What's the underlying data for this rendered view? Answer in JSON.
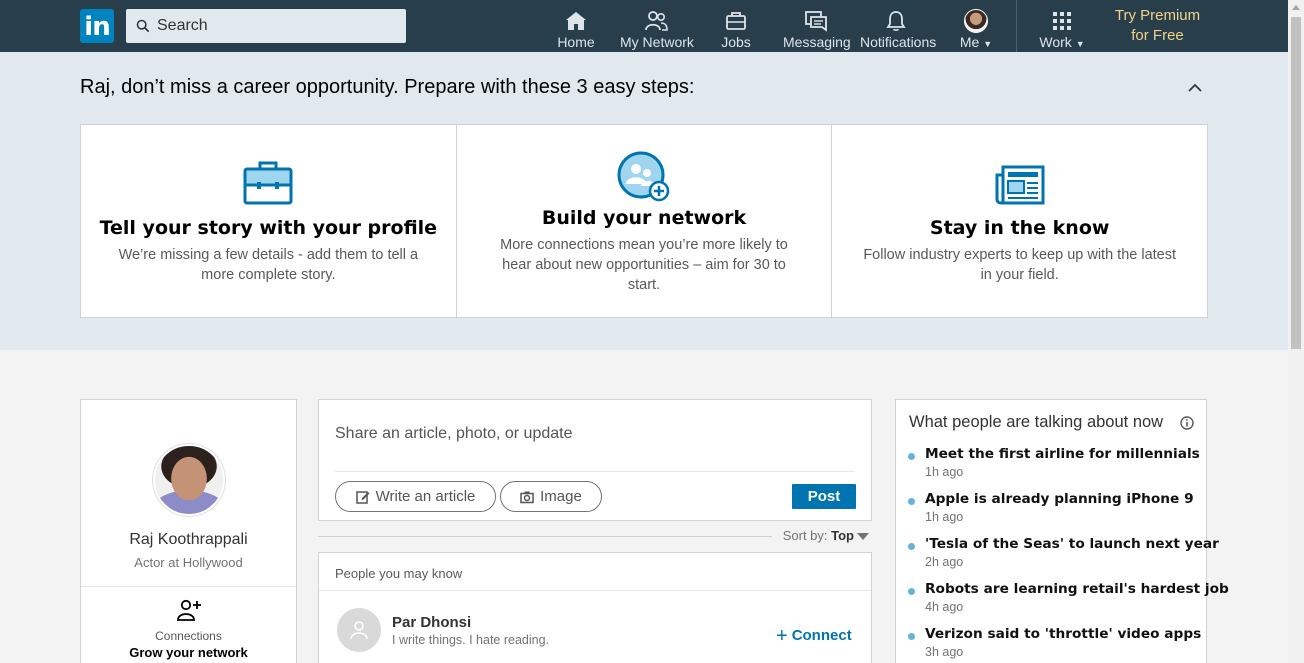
{
  "nav": {
    "search_placeholder": "Search",
    "items": [
      {
        "label": "Home",
        "icon": "home-icon"
      },
      {
        "label": "My Network",
        "icon": "network-icon"
      },
      {
        "label": "Jobs",
        "icon": "briefcase-icon"
      },
      {
        "label": "Messaging",
        "icon": "messaging-icon"
      },
      {
        "label": "Notifications",
        "icon": "bell-icon"
      },
      {
        "label": "Me",
        "icon": "avatar"
      },
      {
        "label": "Work",
        "icon": "grid-icon"
      }
    ],
    "premium_line1": "Try Premium",
    "premium_line2": "for Free"
  },
  "banner": {
    "title": "Raj, don’t miss a career opportunity. Prepare with these 3 easy steps:",
    "steps": [
      {
        "title": "Tell your story with your profile",
        "text": "We’re missing a few details - add them to tell a more complete story."
      },
      {
        "title": "Build your network",
        "text": "More connections mean you’re more likely to hear about new opportunities – aim for 30 to start."
      },
      {
        "title": "Stay in the know",
        "text": "Follow industry experts to keep up with the latest in your field."
      }
    ]
  },
  "profile": {
    "name": "Raj Koothrappali",
    "headline": "Actor at Hollywood",
    "connections_label": "Connections",
    "connections_sub": "Grow your network"
  },
  "share": {
    "placeholder": "Share an article, photo, or update",
    "write_article": "Write an article",
    "image": "Image",
    "post": "Post"
  },
  "sort": {
    "label": "Sort by:",
    "value": "Top"
  },
  "pymk": {
    "title": "People you may know",
    "people": [
      {
        "name": "Par Dhonsi",
        "headline": "I write things. I hate reading.",
        "action": "Connect"
      }
    ]
  },
  "news": {
    "title": "What people are talking about now",
    "items": [
      {
        "headline": "Meet the first airline for millennials",
        "age": "1h ago"
      },
      {
        "headline": "Apple is already planning iPhone 9",
        "age": "1h ago"
      },
      {
        "headline": "'Tesla of the Seas' to launch next year",
        "age": "2h ago"
      },
      {
        "headline": "Robots are learning retail's hardest job",
        "age": "4h ago"
      },
      {
        "headline": "Verizon said to 'throttle' video apps",
        "age": "3h ago"
      }
    ]
  },
  "colors": {
    "navbar": "#283e4a",
    "brand": "#0073b1",
    "banner_bg": "#e1e9ee",
    "premium": "#f0d28a"
  }
}
